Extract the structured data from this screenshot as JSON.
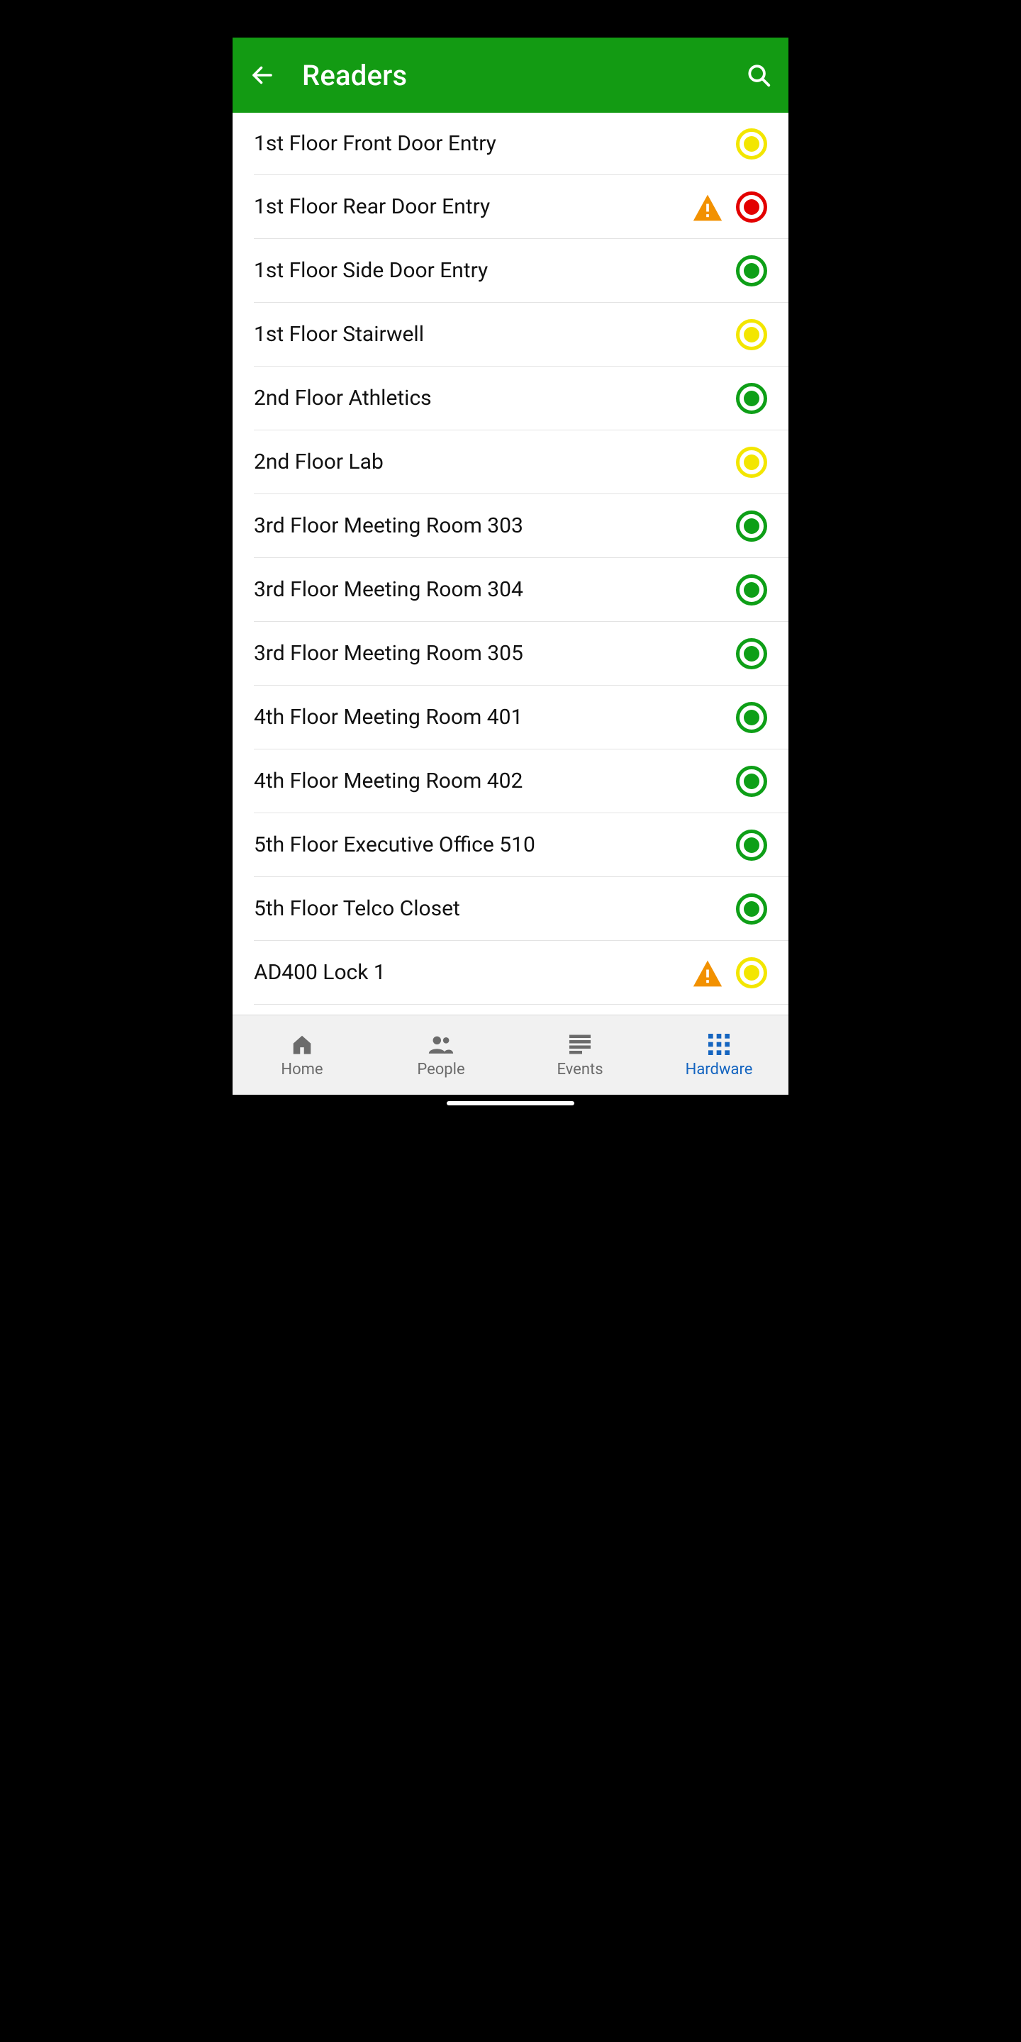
{
  "colors": {
    "brand": "#139b13",
    "green": "#0e9f17",
    "yellow": "#f3e600",
    "red": "#e30000",
    "warning": "#f29100",
    "active_tab": "#1565c0"
  },
  "header": {
    "title": "Readers"
  },
  "readers": [
    {
      "name": "1st Floor Front Door Entry",
      "warning": false,
      "status": "yellow"
    },
    {
      "name": "1st Floor Rear Door Entry",
      "warning": true,
      "status": "red"
    },
    {
      "name": "1st Floor Side Door Entry",
      "warning": false,
      "status": "green"
    },
    {
      "name": "1st Floor Stairwell",
      "warning": false,
      "status": "yellow"
    },
    {
      "name": "2nd Floor Athletics",
      "warning": false,
      "status": "green"
    },
    {
      "name": "2nd Floor Lab",
      "warning": false,
      "status": "yellow"
    },
    {
      "name": "3rd Floor Meeting Room 303",
      "warning": false,
      "status": "green"
    },
    {
      "name": "3rd Floor Meeting Room 304",
      "warning": false,
      "status": "green"
    },
    {
      "name": "3rd Floor Meeting Room 305",
      "warning": false,
      "status": "green"
    },
    {
      "name": "4th Floor Meeting Room 401",
      "warning": false,
      "status": "green"
    },
    {
      "name": "4th Floor Meeting Room 402",
      "warning": false,
      "status": "green"
    },
    {
      "name": "5th Floor Executive Office 510",
      "warning": false,
      "status": "green"
    },
    {
      "name": "5th Floor Telco Closet",
      "warning": false,
      "status": "green"
    },
    {
      "name": "AD400 Lock 1",
      "warning": true,
      "status": "yellow"
    }
  ],
  "nav": {
    "items": [
      {
        "label": "Home",
        "icon": "home-icon",
        "active": false
      },
      {
        "label": "People",
        "icon": "people-icon",
        "active": false
      },
      {
        "label": "Events",
        "icon": "events-icon",
        "active": false
      },
      {
        "label": "Hardware",
        "icon": "grid-icon",
        "active": true
      }
    ]
  }
}
